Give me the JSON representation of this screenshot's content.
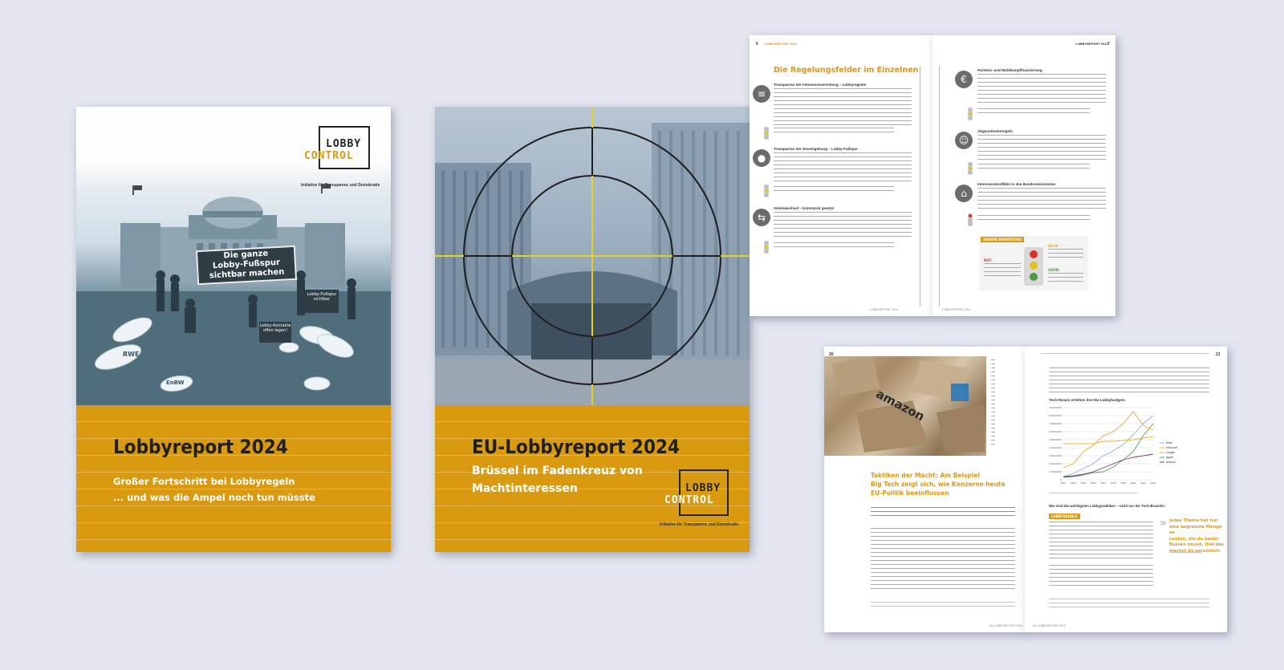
{
  "cover1": {
    "logo_top": "LOBBY",
    "logo_bottom": "CONTROL",
    "tagline": "Initiative für Transparenz und Demokratie",
    "banner_line1": "Die ganze",
    "banner_line2": "Lobby-Fußspur",
    "banner_line3": "sichtbar machen",
    "sign1": "Lobby-Fußspur sichtbar",
    "sign2": "Lobby-Kontakte offen legen!",
    "footprint1": "RWE",
    "footprint2": "EnBW",
    "title": "Lobbyreport 2024",
    "subtitle1": "Großer Fortschritt bei Lobbyregeln",
    "subtitle2": "... und was die Ampel noch tun müsste"
  },
  "cover2": {
    "title": "EU-Lobbyreport 2024",
    "subtitle1": "Brüssel im Fadenkreuz von",
    "subtitle2": "Machtinteressen",
    "logo_top": "LOBBY",
    "logo_bottom": "CONTROL",
    "tagline": "Initiative für Transparenz und Demokratie"
  },
  "spread1": {
    "left_page_no": "6",
    "left_running": "LOBBYREPORT 2024",
    "right_page_no": "7",
    "right_running": "LOBBYREPORT 2024",
    "heading": "Die Regelungsfelder im Einzelnen",
    "sections_left": [
      {
        "title": "Transparenz der Interessenvertretung – Lobbyregister"
      },
      {
        "title": "Transparenz der Gesetzgebung – Lobby-Fußspur"
      },
      {
        "title": "Seitenwechsel – Karenzzeit gesetzt"
      }
    ],
    "sections_right": [
      {
        "title": "Parteien- und Wahlkampffinanzierung"
      },
      {
        "title": "Abgeordnetenregeln"
      },
      {
        "title": "Interessenkonflikte in den Bundesministerien"
      }
    ],
    "legend_title": "UNSERE BEWERTUNG",
    "legend_red": "ROT:",
    "legend_yellow": "GELB:",
    "legend_green": "GRÜN:",
    "footer_left": "LOBBYREPORT 2024",
    "footer_right": "LOBBYREPORT 2024"
  },
  "spread2": {
    "left_page_no": "20",
    "right_page_no": "21",
    "box_label": "amazon",
    "heading1": "Taktiken der Macht: Am Beispiel",
    "heading2": "Big Tech zeigt sich, wie Konzerne heute",
    "heading3": "EU-Politik beeinflussen",
    "chart_title": "Tech-Riesen erhöhen ihre EU-Lobbybudgets",
    "section_head": "Wie sind die wichtigsten Lobbypraktiken – nicht nur der Tech-Branche:",
    "label_box": "LOBBYKANÄLE",
    "quote1": "Jedes Thema hat nur",
    "quote2": "eine begrenzte Menge an",
    "quote3": "Leuten, die du beein-",
    "quote4": "flussen musst. Und das",
    "quote5": "machst du persönlich.",
    "footer_left": "EU-LOBBYREPORT 2024",
    "footer_right": "EU-LOBBYREPORT 2024"
  },
  "chart_data": {
    "type": "line",
    "title": "Tech-Riesen erhöhen ihre EU-Lobbybudgets",
    "x": [
      "2013",
      "2014",
      "2015",
      "2016",
      "2017",
      "2018",
      "2019",
      "2020",
      "2021",
      "2022"
    ],
    "series": [
      {
        "name": "Meta",
        "color": "#8fb3cf",
        "values": [
          0.4,
          0.8,
          1.4,
          2.0,
          3.0,
          3.6,
          4.4,
          5.6,
          7.0,
          8.0
        ]
      },
      {
        "name": "Microsoft",
        "color": "#f0b429",
        "values": [
          4.5,
          4.5,
          4.5,
          4.5,
          4.8,
          4.8,
          4.9,
          5.0,
          5.2,
          5.4
        ]
      },
      {
        "name": "Google",
        "color": "#e8a53a",
        "values": [
          1.5,
          2.0,
          3.5,
          4.3,
          5.5,
          6.0,
          7.0,
          8.5,
          6.8,
          6.2
        ]
      },
      {
        "name": "Apple",
        "color": "#5aa05a",
        "values": [
          0.3,
          0.4,
          0.6,
          0.9,
          1.0,
          1.6,
          2.5,
          3.5,
          5.5,
          7.0
        ]
      },
      {
        "name": "Amazon",
        "color": "#7a3a6a",
        "values": [
          0.4,
          0.5,
          0.7,
          1.0,
          1.5,
          2.0,
          2.5,
          2.8,
          3.0,
          3.2
        ]
      }
    ],
    "ylim": [
      0,
      9
    ],
    "yticks": [
      "0",
      "1.000.000 €",
      "2.000.000 €",
      "3.000.000 €",
      "4.000.000 €",
      "5.000.000 €",
      "6.000.000 €",
      "7.000.000 €",
      "8.000.000 €",
      "9.000.000 €"
    ],
    "legend_position": "right",
    "grid": true
  }
}
